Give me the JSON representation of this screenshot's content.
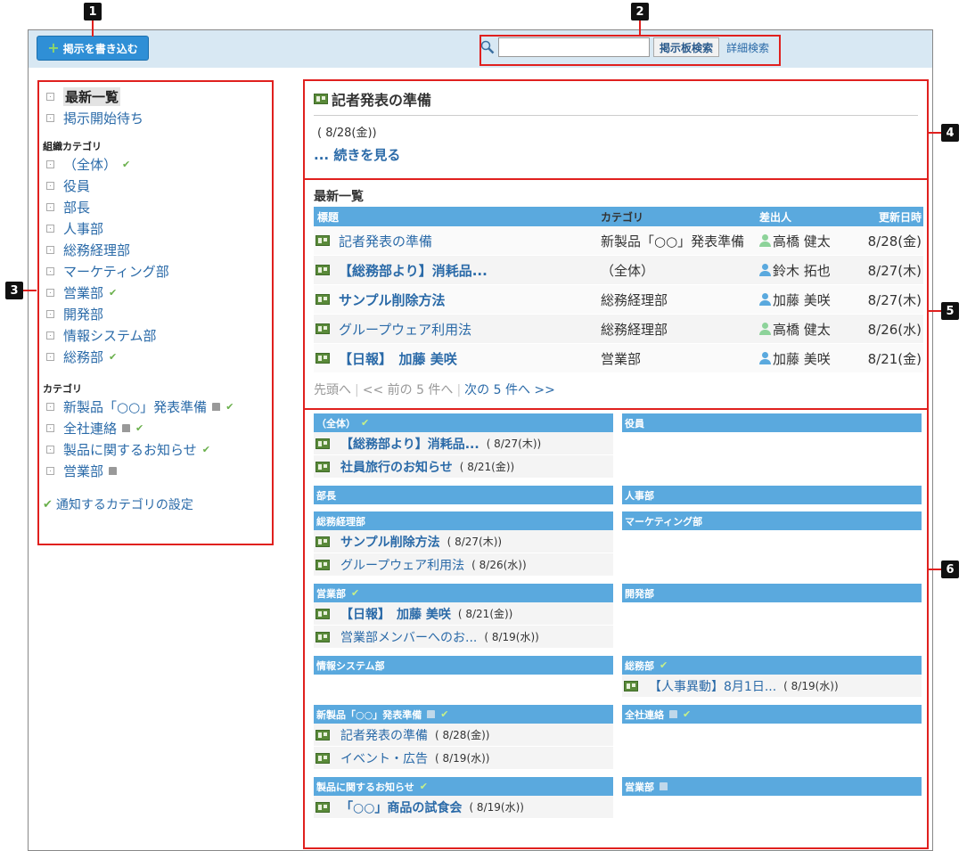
{
  "toolbar": {
    "write_label": "掲示を書き込む"
  },
  "search": {
    "placeholder": "",
    "button_label": "掲示板検索",
    "advanced_label": "詳細検索"
  },
  "sidebar": {
    "views": [
      {
        "label": "最新一覧"
      },
      {
        "label": "掲示開始待ち"
      }
    ],
    "org_header": "組織カテゴリ",
    "org_items": [
      {
        "label": "（全体）"
      },
      {
        "label": "役員"
      },
      {
        "label": "部長"
      },
      {
        "label": "人事部"
      },
      {
        "label": "総務経理部"
      },
      {
        "label": "マーケティング部"
      },
      {
        "label": "営業部"
      },
      {
        "label": "開発部"
      },
      {
        "label": "情報システム部"
      },
      {
        "label": "総務部"
      }
    ],
    "cat_header": "カテゴリ",
    "cat_items": [
      {
        "label": "新製品「○○」発表準備"
      },
      {
        "label": "全社連絡"
      },
      {
        "label": "製品に関するお知らせ"
      },
      {
        "label": "営業部"
      }
    ],
    "notify_label": "通知するカテゴリの設定"
  },
  "featured": {
    "title": "記者発表の準備",
    "date": "( 8/28(金))",
    "more": "... 続きを見る"
  },
  "latest": {
    "title": "最新一覧",
    "headers": {
      "subject": "標題",
      "category": "カテゴリ",
      "sender": "差出人",
      "updated": "更新日時"
    },
    "rows": [
      {
        "subject": "記者発表の準備",
        "category": "新製品「○○」発表準備",
        "sender": "高橋 健太",
        "date": "8/28(金)"
      },
      {
        "subject": "【総務部より】消耗品...",
        "category": "（全体）",
        "sender": "鈴木 拓也",
        "date": "8/27(木)"
      },
      {
        "subject": "サンプル削除方法",
        "category": "総務経理部",
        "sender": "加藤 美咲",
        "date": "8/27(木)"
      },
      {
        "subject": "グループウェア利用法",
        "category": "総務経理部",
        "sender": "高橋 健太",
        "date": "8/26(水)"
      },
      {
        "subject": "【日報】　加藤 美咲",
        "category": "営業部",
        "sender": "加藤 美咲",
        "date": "8/21(金)"
      }
    ],
    "pager": {
      "first": "先頭へ",
      "prev": "<< 前の 5 件へ",
      "next": "次の 5 件へ >>"
    }
  },
  "categories": {
    "all": {
      "name": "（全体）",
      "entries": [
        {
          "title": "【総務部より】消耗品...",
          "date": "( 8/27(木))"
        },
        {
          "title": "社員旅行のお知らせ",
          "date": "( 8/21(金))"
        }
      ]
    },
    "exec": {
      "name": "役員"
    },
    "managers": {
      "name": "部長"
    },
    "hr": {
      "name": "人事部"
    },
    "genacct": {
      "name": "総務経理部",
      "entries": [
        {
          "title": "サンプル削除方法",
          "date": "( 8/27(木))"
        },
        {
          "title": "グループウェア利用法",
          "date": "( 8/26(水))"
        }
      ]
    },
    "marketing": {
      "name": "マーケティング部"
    },
    "sales": {
      "name": "営業部",
      "entries": [
        {
          "title": "【日報】　加藤 美咲",
          "date": "( 8/21(金))"
        },
        {
          "title": "営業部メンバーへのお...",
          "date": "( 8/19(水))"
        }
      ]
    },
    "dev": {
      "name": "開発部"
    },
    "is": {
      "name": "情報システム部"
    },
    "general": {
      "name": "総務部",
      "entries": [
        {
          "title": "【人事異動】8月1日...",
          "date": "( 8/19(水))"
        }
      ]
    },
    "newprod": {
      "name": "新製品「○○」発表準備",
      "entries": [
        {
          "title": "記者発表の準備",
          "date": "( 8/28(金))"
        },
        {
          "title": "イベント・広告",
          "date": "( 8/19(水))"
        }
      ]
    },
    "company": {
      "name": "全社連絡"
    },
    "productnews": {
      "name": "製品に関するお知らせ",
      "entries": [
        {
          "title": "「○○」商品の試食会",
          "date": "( 8/19(水))"
        }
      ]
    },
    "sales2": {
      "name": "営業部"
    }
  },
  "callouts": {
    "n1": "1",
    "n2": "2",
    "n3": "3",
    "n4": "4",
    "n5": "5",
    "n6": "6"
  },
  "colors": {
    "header_blue": "#5aa9de",
    "link_blue": "#2a6aa8",
    "highlight_red": "#e0201e",
    "user_green": "#8dd39a",
    "user_blue": "#5aa9de"
  }
}
